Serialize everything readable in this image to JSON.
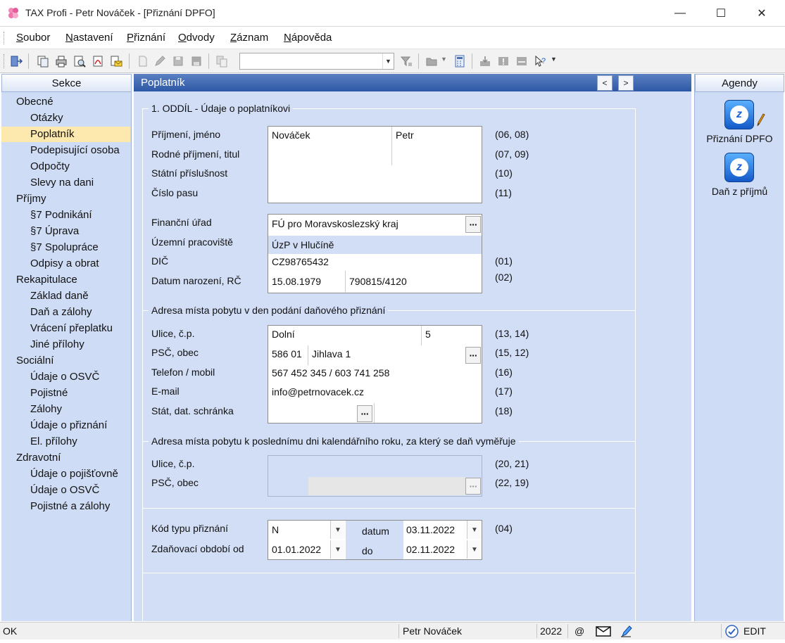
{
  "window": {
    "title": "TAX Profi - Petr Nováček - [Přiznání DPFO]",
    "min": "—",
    "max": "☐",
    "close": "✕"
  },
  "menu": [
    {
      "accel": "S",
      "rest": "oubor"
    },
    {
      "accel": "N",
      "rest": "astavení"
    },
    {
      "accel": "P",
      "rest": "řiznání"
    },
    {
      "accel": "O",
      "rest": "dvody"
    },
    {
      "accel": "Z",
      "rest": "áznam"
    },
    {
      "accel": "N",
      "rest": "ápověda"
    }
  ],
  "toolbar": {
    "combo_value": ""
  },
  "sekce": {
    "header": "Sekce",
    "items": [
      {
        "label": "Obecné",
        "level": 0
      },
      {
        "label": "Otázky",
        "level": 1
      },
      {
        "label": "Poplatník",
        "level": 1,
        "selected": true
      },
      {
        "label": "Podepisující osoba",
        "level": 1
      },
      {
        "label": "Odpočty",
        "level": 1
      },
      {
        "label": "Slevy na dani",
        "level": 1
      },
      {
        "label": "Příjmy",
        "level": 0
      },
      {
        "label": "§7 Podnikání",
        "level": 1
      },
      {
        "label": "§7 Úprava",
        "level": 1
      },
      {
        "label": "§7 Spolupráce",
        "level": 1
      },
      {
        "label": "Odpisy a obrat",
        "level": 1
      },
      {
        "label": "Rekapitulace",
        "level": 0
      },
      {
        "label": "Základ daně",
        "level": 1
      },
      {
        "label": "Daň a zálohy",
        "level": 1
      },
      {
        "label": "Vrácení přeplatku",
        "level": 1
      },
      {
        "label": "Jiné přílohy",
        "level": 1
      },
      {
        "label": "Sociální",
        "level": 0
      },
      {
        "label": "Údaje o OSVČ",
        "level": 1
      },
      {
        "label": "Pojistné",
        "level": 1
      },
      {
        "label": "Zálohy",
        "level": 1
      },
      {
        "label": "Údaje o přiznání",
        "level": 1
      },
      {
        "label": "El. přílohy",
        "level": 1
      },
      {
        "label": "Zdravotní",
        "level": 0
      },
      {
        "label": "Údaje o pojišťovně",
        "level": 1
      },
      {
        "label": "Údaje o OSVČ",
        "level": 1
      },
      {
        "label": "Pojistné a zálohy",
        "level": 1
      }
    ]
  },
  "content": {
    "header": "Poplatník",
    "section1": {
      "title": "1. ODDÍL - Údaje o poplatníkovi",
      "labels": [
        "Příjmení, jméno",
        "Rodné příjmení, titul",
        "Státní příslušnost",
        "Číslo pasu"
      ],
      "codes": [
        "(06, 08)",
        "(07, 09)",
        "(10)",
        "(11)"
      ],
      "prijmeni": "Nováček",
      "jmeno": "Petr"
    },
    "section2": {
      "labels": [
        "Finanční úřad",
        "Územní pracoviště",
        "DIČ",
        "Datum narození, RČ"
      ],
      "codes": [
        "(01)",
        "(02)"
      ],
      "financni_urad": "FÚ pro Moravskoslezský kraj",
      "uzemni_pracoviste": "ÚzP v Hlučíně",
      "dic": "CZ98765432",
      "datum_narozeni": "15.08.1979",
      "rc": "790815/4120"
    },
    "section3": {
      "title": "Adresa místa pobytu v den podání daňového přiznání",
      "labels": [
        "Ulice, č.p.",
        "PSČ, obec",
        "Telefon / mobil",
        "E-mail",
        "Stát, dat. schránka"
      ],
      "codes": [
        "(13, 14)",
        "(15, 12)",
        "(16)",
        "(17)",
        "(18)"
      ],
      "ulice": "Dolní",
      "cp": "5",
      "psc": "586 01",
      "obec": "Jihlava 1",
      "telefon": "567 452 345 / 603 741 258",
      "email": "info@petrnovacek.cz"
    },
    "section4": {
      "title": "Adresa místa pobytu k poslednímu dni kalendářního roku, za který se daň vyměřuje",
      "labels": [
        "Ulice, č.p.",
        "PSČ, obec"
      ],
      "codes": [
        "(20, 21)",
        "(22, 19)"
      ]
    },
    "section5": {
      "labels": [
        "Kód typu přiznání",
        "Zdaňovací období od"
      ],
      "kod": "N",
      "datum_label": "datum",
      "datum": "03.11.2022",
      "od": "01.01.2022",
      "do_label": "do",
      "do": "02.11.2022",
      "code": "(04)"
    }
  },
  "agendy": {
    "header": "Agendy",
    "items": [
      {
        "label": "Přiznání DPFO"
      },
      {
        "label": "Daň z příjmů"
      }
    ]
  },
  "status": {
    "left": "OK",
    "user": "Petr Nováček",
    "year": "2022",
    "at": "@",
    "mode": "EDIT"
  },
  "colors": {
    "accent": "#2d58a6",
    "panel": "#d1def5",
    "selected": "#fde9ae"
  }
}
